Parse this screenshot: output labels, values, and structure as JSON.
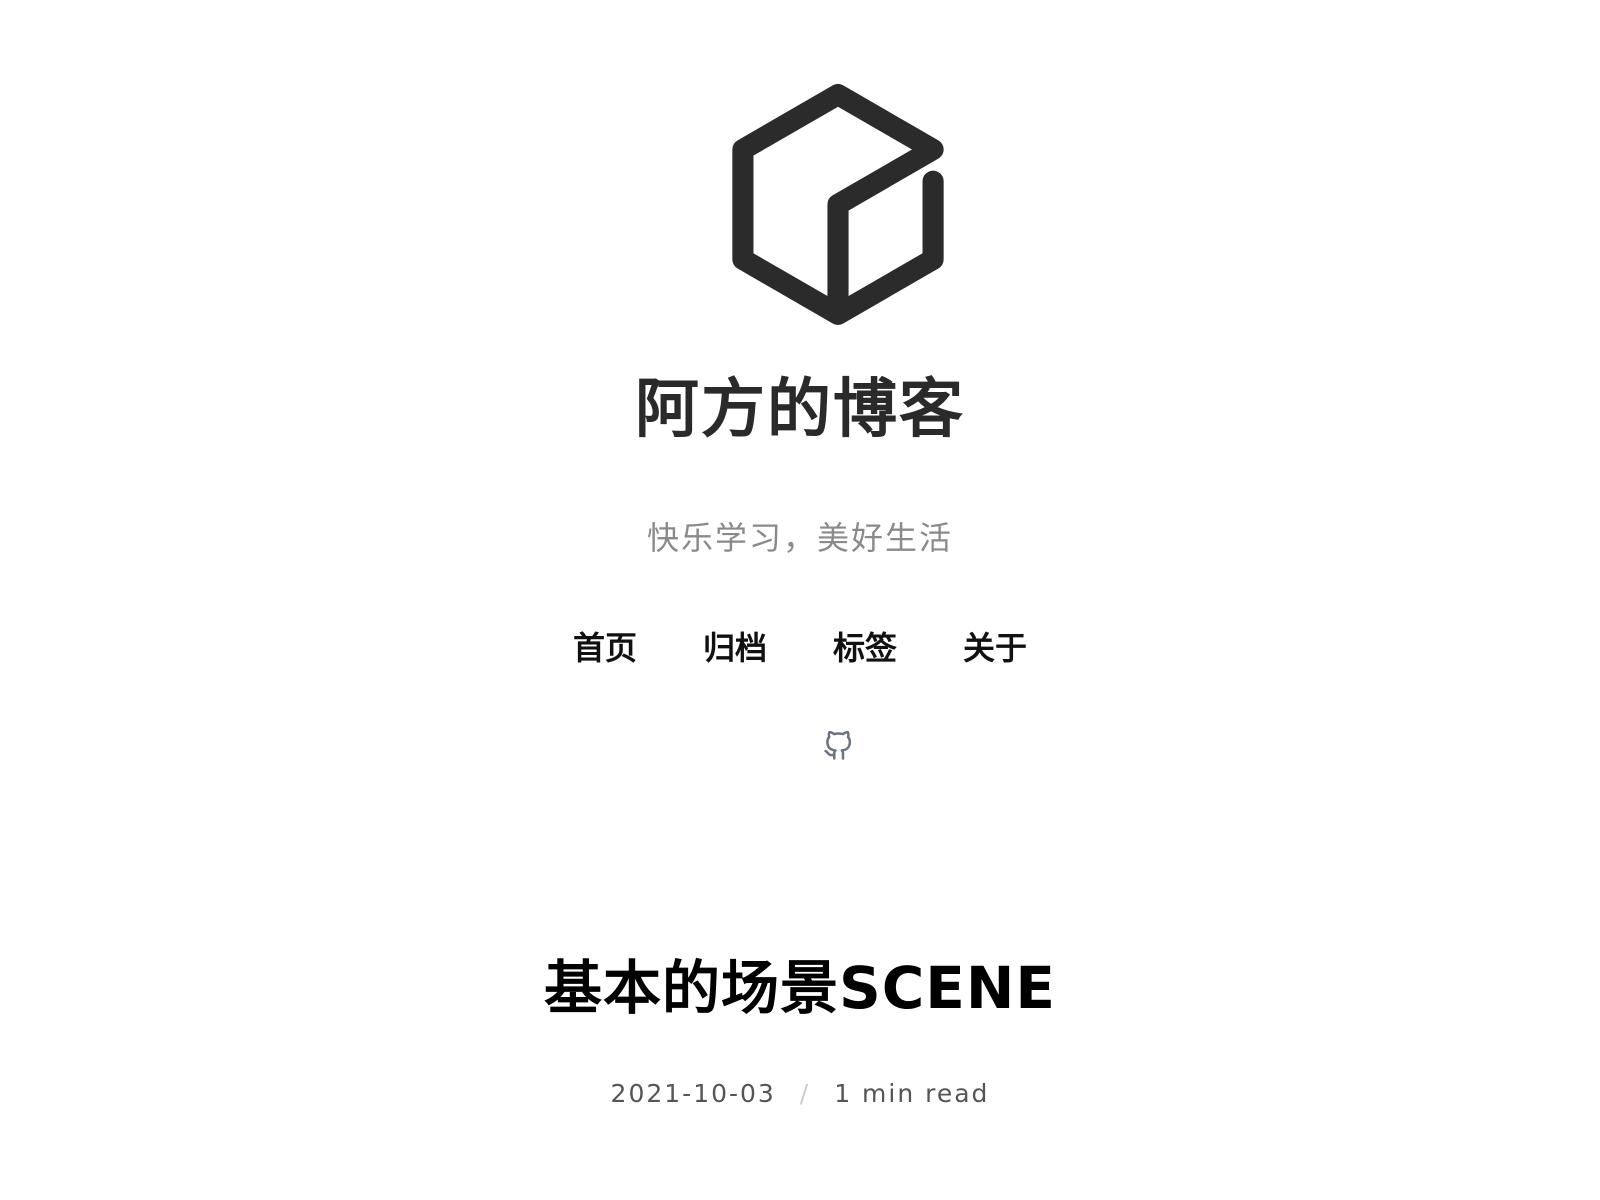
{
  "site": {
    "title": "阿方的博客",
    "subtitle": "快乐学习，美好生活",
    "logo_icon": "cube-icon"
  },
  "nav": {
    "items": [
      {
        "label": "首页"
      },
      {
        "label": "归档"
      },
      {
        "label": "标签"
      },
      {
        "label": "关于"
      }
    ]
  },
  "social": {
    "icons": [
      "github-icon"
    ]
  },
  "post": {
    "title": "基本的场景SCENE",
    "date": "2021-10-03",
    "separator": "/",
    "read_time": "1 min read"
  },
  "colors": {
    "title": "#2a2a2a",
    "subtitle": "#8a8a8a",
    "nav": "#111111",
    "social_icon": "#6b7280",
    "meta": "#555555"
  }
}
